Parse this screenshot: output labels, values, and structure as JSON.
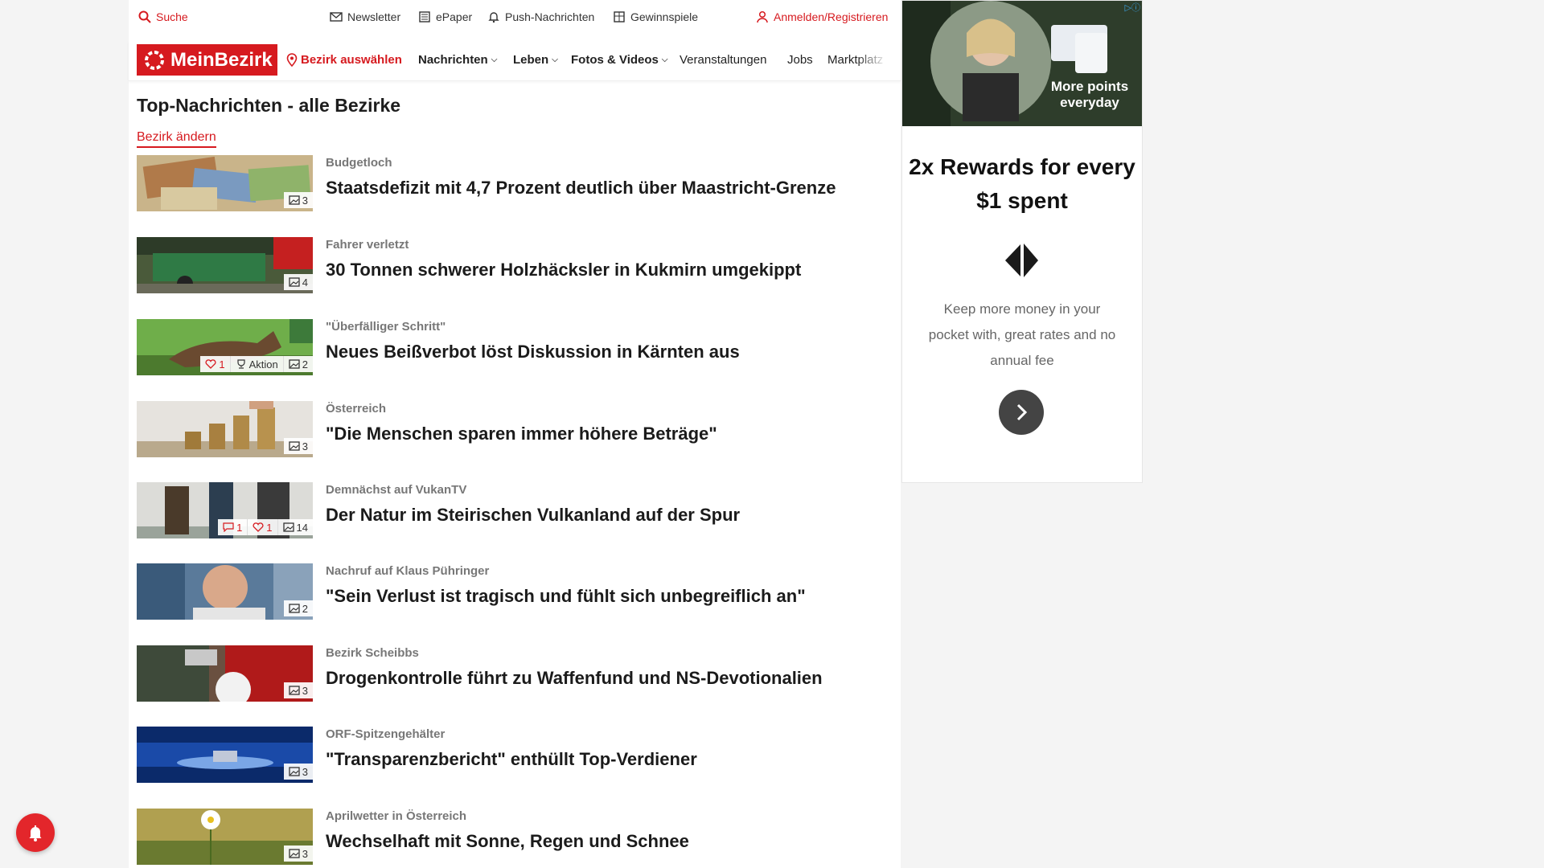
{
  "util": {
    "search": "Suche",
    "newsletter": "Newsletter",
    "epaper": "ePaper",
    "push": "Push-Nachrichten",
    "gewinnspiele": "Gewinnspiele",
    "login": "Anmelden/Registrieren"
  },
  "nav": {
    "logo": "MeinBezirk",
    "bezirk": "Bezirk auswählen",
    "items": [
      "Nachrichten",
      "Leben",
      "Fotos & Videos",
      "Veranstaltungen",
      "Jobs",
      "Marktplatz"
    ]
  },
  "main": {
    "title": "Top-Nachrichten - alle Bezirke",
    "change": "Bezirk ändern"
  },
  "articles": [
    {
      "kicker": "Budgetloch",
      "headline": "Staatsdefizit mit 4,7 Prozent deutlich über Maastricht-Grenze",
      "photos": "3"
    },
    {
      "kicker": "Fahrer verletzt",
      "headline": "30 Tonnen schwerer Holzhäcksler in Kukmirn umgekippt",
      "photos": "4"
    },
    {
      "kicker": "\"Überfälliger Schritt\"",
      "headline": "Neues Beißverbot löst Diskussion in Kärnten aus",
      "likes": "1",
      "action": "Aktion",
      "photos": "2"
    },
    {
      "kicker": "Österreich",
      "headline": "\"Die Menschen sparen immer höhere Beträge\"",
      "photos": "3"
    },
    {
      "kicker": "Demnächst auf VukanTV",
      "headline": "Der Natur im Steirischen Vulkanland auf der Spur",
      "comments": "1",
      "likes": "1",
      "photos": "14"
    },
    {
      "kicker": "Nachruf auf Klaus Pühringer",
      "headline": "\"Sein Verlust ist tragisch und fühlt sich unbegreiflich an\"",
      "photos": "2"
    },
    {
      "kicker": "Bezirk Scheibbs",
      "headline": "Drogenkontrolle führt zu Waffenfund und NS-Devotionalien",
      "photos": "3"
    },
    {
      "kicker": "ORF-Spitzengehälter",
      "headline": "\"Transparenzbericht\" enthüllt Top-Verdiener",
      "photos": "3"
    },
    {
      "kicker": "Aprilwetter in Österreich",
      "headline": "Wechselhaft mit Sonne, Regen und Schnee",
      "photos": "3"
    }
  ],
  "ad": {
    "image_text": "More points everyday",
    "title": "2x Rewards for every $1 spent",
    "body": "Keep more money in your pocket with, great rates and no annual fee"
  },
  "colors": {
    "brand": "#d61a1f",
    "background": "#f4f4f4"
  },
  "icons": {
    "search": "search-icon",
    "newsletter": "mail-icon",
    "epaper": "newspaper-icon",
    "push": "bell-icon",
    "gewinnspiele": "gift-icon",
    "login": "user-icon",
    "location": "pin-icon",
    "photos": "image-icon",
    "likes": "heart-icon",
    "comments": "comment-icon",
    "action": "trophy-icon"
  }
}
